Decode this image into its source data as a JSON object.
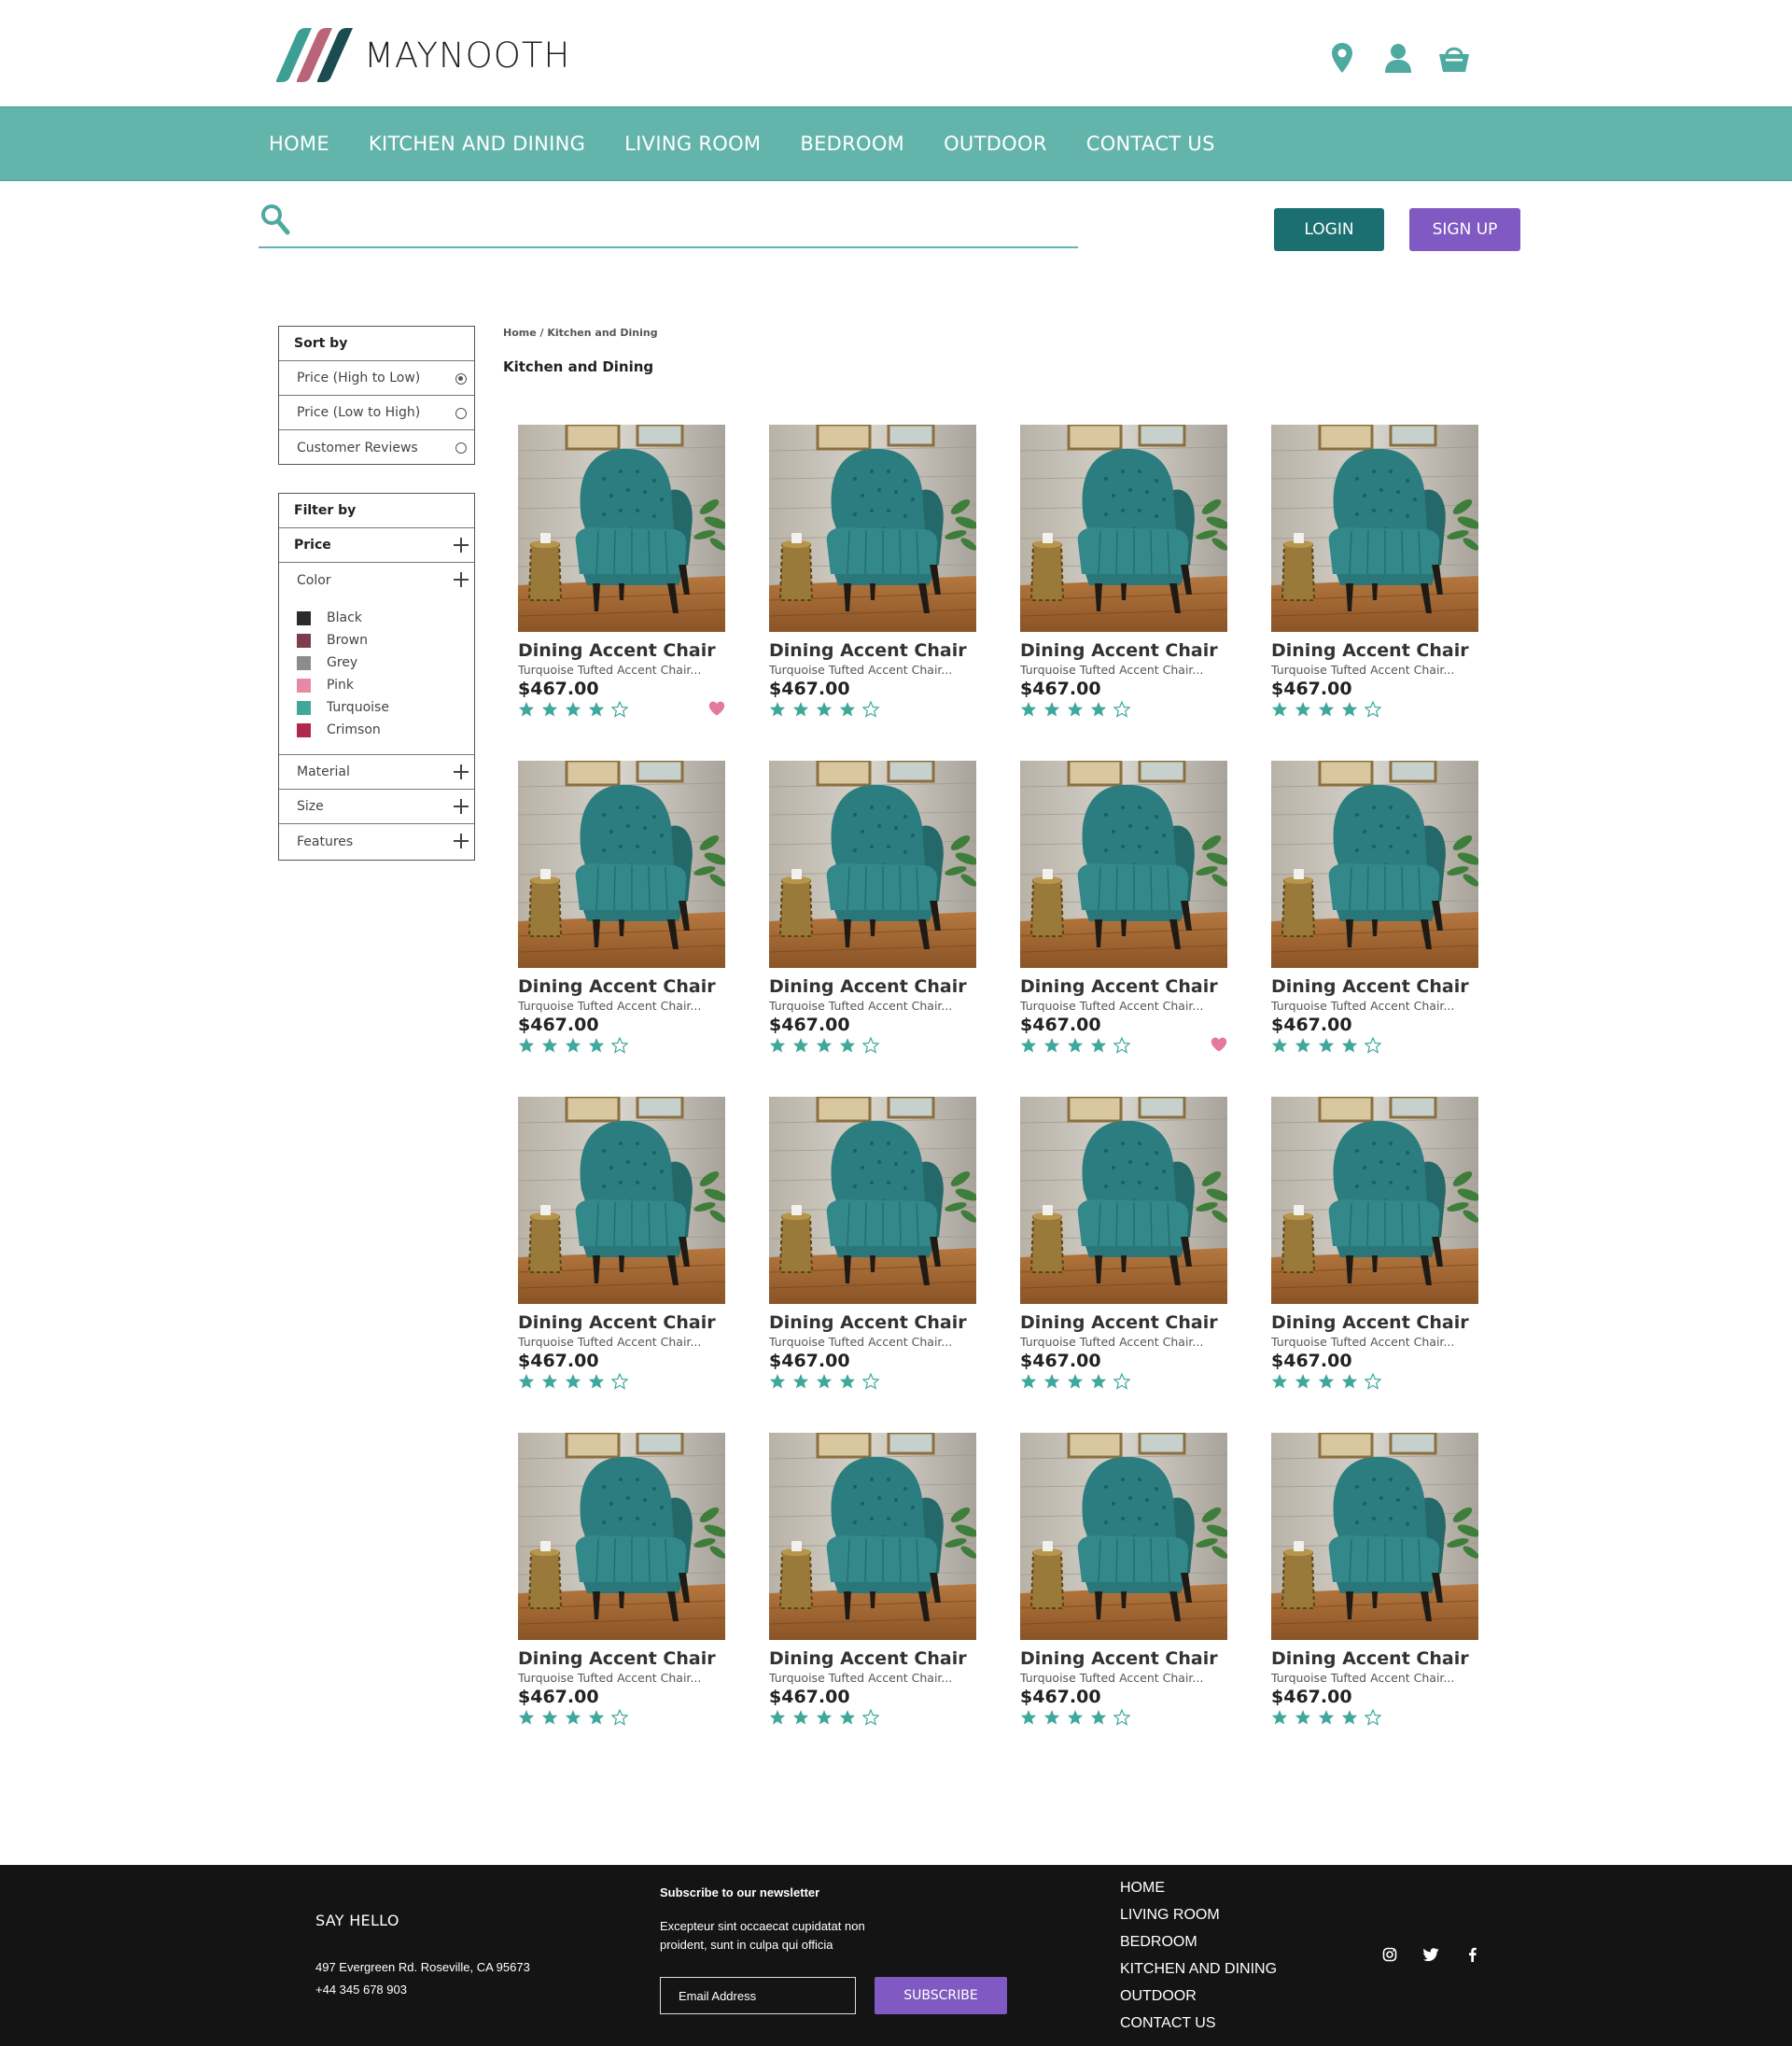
{
  "brand": {
    "name": "MAYNOOTH",
    "accent": "#63b5ab",
    "dark_teal": "#1c6f70",
    "purple": "#8059c2"
  },
  "header": {
    "icons": [
      "location-pin-icon",
      "user-icon",
      "shopping-basket-icon"
    ]
  },
  "nav": {
    "items": [
      "HOME",
      "KITCHEN AND DINING",
      "LIVING ROOM",
      "BEDROOM",
      "OUTDOOR",
      "CONTACT US"
    ]
  },
  "search": {
    "value": "",
    "placeholder": ""
  },
  "auth": {
    "login": "LOGIN",
    "signup": "SIGN UP"
  },
  "sort": {
    "title": "Sort by",
    "options": [
      {
        "label": "Price (High to Low)",
        "selected": true
      },
      {
        "label": "Price (Low to High)",
        "selected": false
      },
      {
        "label": "Customer Reviews",
        "selected": false
      }
    ]
  },
  "filter": {
    "title": "Filter by",
    "price": "Price",
    "color": "Color",
    "colors": [
      {
        "name": "Black",
        "hex": "#2b2b2b"
      },
      {
        "name": "Brown",
        "hex": "#7b3e4a"
      },
      {
        "name": "Grey",
        "hex": "#8c8c8c"
      },
      {
        "name": "Pink",
        "hex": "#e58aa5"
      },
      {
        "name": "Turquoise",
        "hex": "#3fa89b"
      },
      {
        "name": "Crimson",
        "hex": "#b0284f"
      }
    ],
    "material": "Material",
    "size": "Size",
    "features": "Features"
  },
  "breadcrumb": {
    "home": "Home",
    "separator": " / ",
    "current": "Kitchen and Dining"
  },
  "page_title": "Kitchen and Dining",
  "products": [
    {
      "name": "Dining Accent Chair",
      "desc": "Turquoise Tufted Accent Chair...",
      "price": "$467.00",
      "rating": 4,
      "favorite": true
    },
    {
      "name": "Dining Accent Chair",
      "desc": "Turquoise Tufted Accent Chair...",
      "price": "$467.00",
      "rating": 4,
      "favorite": false
    },
    {
      "name": "Dining Accent Chair",
      "desc": "Turquoise Tufted Accent Chair...",
      "price": "$467.00",
      "rating": 4,
      "favorite": false
    },
    {
      "name": "Dining Accent Chair",
      "desc": "Turquoise Tufted Accent Chair...",
      "price": "$467.00",
      "rating": 4,
      "favorite": false
    },
    {
      "name": "Dining Accent Chair",
      "desc": "Turquoise Tufted Accent Chair...",
      "price": "$467.00",
      "rating": 4,
      "favorite": false
    },
    {
      "name": "Dining Accent Chair",
      "desc": "Turquoise Tufted Accent Chair...",
      "price": "$467.00",
      "rating": 4,
      "favorite": false
    },
    {
      "name": "Dining Accent Chair",
      "desc": "Turquoise Tufted Accent Chair...",
      "price": "$467.00",
      "rating": 4,
      "favorite": true
    },
    {
      "name": "Dining Accent Chair",
      "desc": "Turquoise Tufted Accent Chair...",
      "price": "$467.00",
      "rating": 4,
      "favorite": false
    },
    {
      "name": "Dining Accent Chair",
      "desc": "Turquoise Tufted Accent Chair...",
      "price": "$467.00",
      "rating": 4,
      "favorite": false
    },
    {
      "name": "Dining Accent Chair",
      "desc": "Turquoise Tufted Accent Chair...",
      "price": "$467.00",
      "rating": 4,
      "favorite": false
    },
    {
      "name": "Dining Accent Chair",
      "desc": "Turquoise Tufted Accent Chair...",
      "price": "$467.00",
      "rating": 4,
      "favorite": false
    },
    {
      "name": "Dining Accent Chair",
      "desc": "Turquoise Tufted Accent Chair...",
      "price": "$467.00",
      "rating": 4,
      "favorite": false
    },
    {
      "name": "Dining Accent Chair",
      "desc": "Turquoise Tufted Accent Chair...",
      "price": "$467.00",
      "rating": 4,
      "favorite": false
    },
    {
      "name": "Dining Accent Chair",
      "desc": "Turquoise Tufted Accent Chair...",
      "price": "$467.00",
      "rating": 4,
      "favorite": false
    },
    {
      "name": "Dining Accent Chair",
      "desc": "Turquoise Tufted Accent Chair...",
      "price": "$467.00",
      "rating": 4,
      "favorite": false
    },
    {
      "name": "Dining Accent Chair",
      "desc": "Turquoise Tufted Accent Chair...",
      "price": "$467.00",
      "rating": 4,
      "favorite": false
    }
  ],
  "footer": {
    "say_hello": "SAY HELLO",
    "address": "497 Evergreen Rd. Roseville, CA 95673",
    "phone": "+44 345 678 903",
    "newsletter_title": "Subscribe to our newsletter",
    "newsletter_text": "Excepteur sint occaecat cupidatat non proident, sunt in culpa qui officia",
    "email_placeholder": "Email Address",
    "subscribe": "SUBSCRIBE",
    "links": [
      "HOME",
      "LIVING ROOM",
      "BEDROOM",
      "KITCHEN AND DINING",
      "OUTDOOR",
      "CONTACT US"
    ],
    "social": [
      "instagram-icon",
      "twitter-icon",
      "facebook-icon"
    ]
  }
}
